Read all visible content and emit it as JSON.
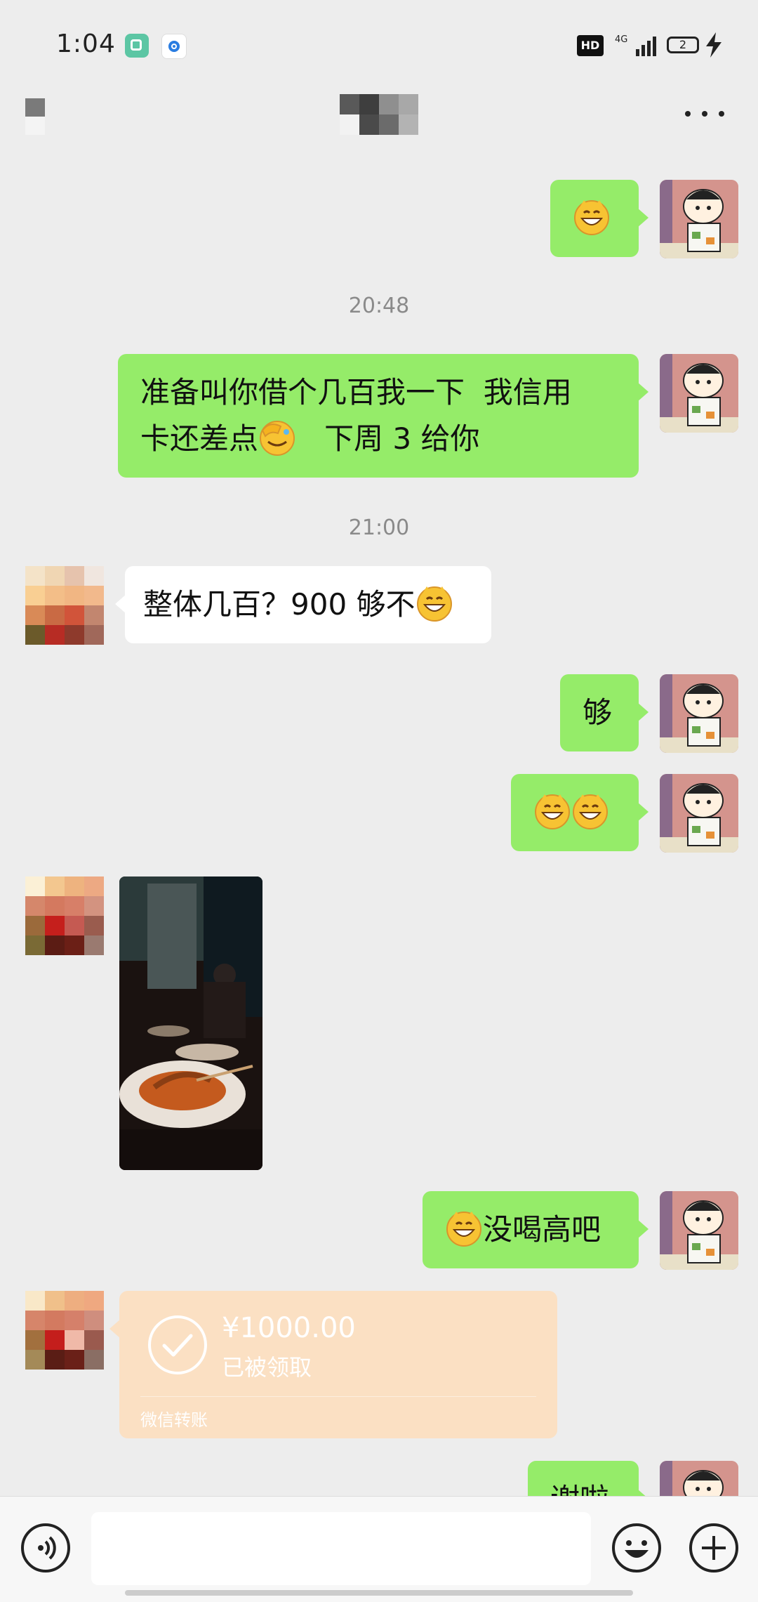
{
  "status_bar": {
    "time": "1:04",
    "hd_label": "HD",
    "network_label": "4G",
    "battery_level": "2"
  },
  "nav_bar": {
    "title": "",
    "back_icon": "back-arrow-icon",
    "more_icon": "more-dots-icon"
  },
  "messages": [
    {
      "from": "me",
      "text": "",
      "emoji": "grin"
    },
    {
      "timestamp": "20:48"
    },
    {
      "from": "me",
      "text": "准备叫你借个几百我一下  我信用\n卡还差点",
      "emoji_after_line2": "facepalm",
      "text_tail": "   下周 3 给你"
    },
    {
      "timestamp": "21:00"
    },
    {
      "from": "peer",
      "text": "整体几百？900 够不",
      "emoji": "grin"
    },
    {
      "from": "me",
      "text": "够"
    },
    {
      "from": "me",
      "text": "",
      "emoji": "grin grin"
    },
    {
      "from": "peer",
      "type": "image",
      "alt": "restaurant-photo"
    },
    {
      "from": "me",
      "text": "没喝高吧",
      "emoji": "grin"
    },
    {
      "from": "peer",
      "type": "transfer",
      "amount": "¥1000.00",
      "status": "已被领取",
      "footer": "微信转账"
    },
    {
      "from": "me",
      "text": "谢啦",
      "partial": true
    }
  ],
  "input_bar": {
    "placeholder": "",
    "voice_icon": "voice-icon",
    "emoji_icon": "smiley-icon",
    "plus_icon": "plus-icon"
  },
  "colors": {
    "background": "#ededed",
    "my_bubble": "#95ec69",
    "peer_bubble": "#ffffff",
    "transfer_received": "#fbe0c3"
  }
}
